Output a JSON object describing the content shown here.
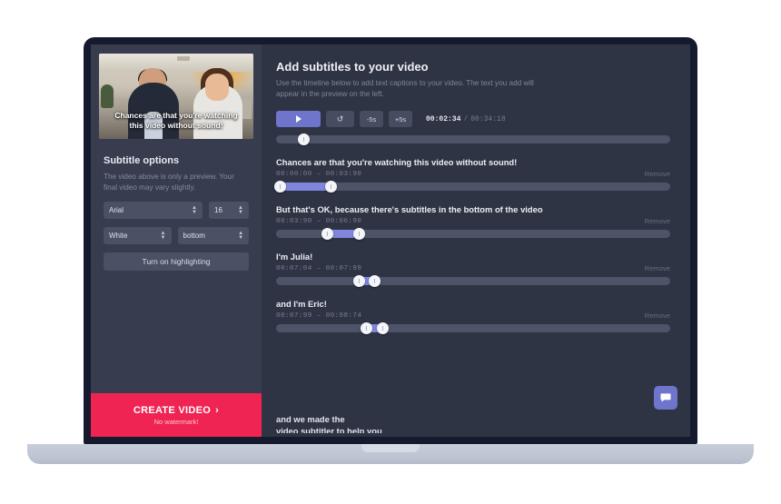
{
  "app": {
    "accent_purple": "#6f74cd",
    "accent_red": "#ef2453",
    "panel_bg": "#2f3444",
    "sidebar_bg": "#373d4f"
  },
  "preview": {
    "caption_line1": "Chances are that you're watching",
    "caption_line2": "this video without sound!"
  },
  "sidebar": {
    "options_title": "Subtitle options",
    "options_desc": "The video above is only a preview. Your final video may vary slightly.",
    "font_select": {
      "value": "Arial",
      "name": "font-family-select"
    },
    "size_select": {
      "value": "16",
      "name": "font-size-select"
    },
    "color_select": {
      "value": "White",
      "name": "font-color-select"
    },
    "position_select": {
      "value": "bottom",
      "name": "caption-position-select"
    },
    "highlighting_button": "Turn on highlighting",
    "create_video_label": "CREATE VIDEO",
    "create_video_chevron": "›",
    "create_video_sub": "No watermark!"
  },
  "main": {
    "title": "Add subtitles to your video",
    "description": "Use the timeline below to add text captions to your video. The text you add will appear in the preview on the left.",
    "controls": {
      "play_icon": "play-icon",
      "restart_icon": "↺",
      "back_5s": "-5s",
      "forward_5s": "+5s",
      "current_time": "00:02:34",
      "separator": "/",
      "total_time": "00:34:18"
    },
    "scrubber": {
      "position_pct": 7
    },
    "remove_label": "Remove",
    "subtitles": [
      {
        "text": "Chances are that you're watching this video without sound!",
        "start": "00:00:00",
        "dash": "–",
        "end": "00:03:90",
        "range_start_pct": 1,
        "range_end_pct": 14
      },
      {
        "text": "But that's OK, because there's subtitles in the bottom of the video",
        "start": "00:03:90",
        "dash": "–",
        "end": "00:06:90",
        "range_start_pct": 13,
        "range_end_pct": 21
      },
      {
        "text": "I'm Julia!",
        "start": "00:07:04",
        "dash": "–",
        "end": "00:07:99",
        "range_start_pct": 21,
        "range_end_pct": 25
      },
      {
        "text": "and I'm Eric!",
        "start": "00:07:99",
        "dash": "–",
        "end": "00:08:74",
        "range_start_pct": 23,
        "range_end_pct": 27
      }
    ],
    "last_partial_line1": "and we made the",
    "last_partial_line2": "video subtitler to help you",
    "chat_button_icon": "chat-bubble-icon"
  }
}
